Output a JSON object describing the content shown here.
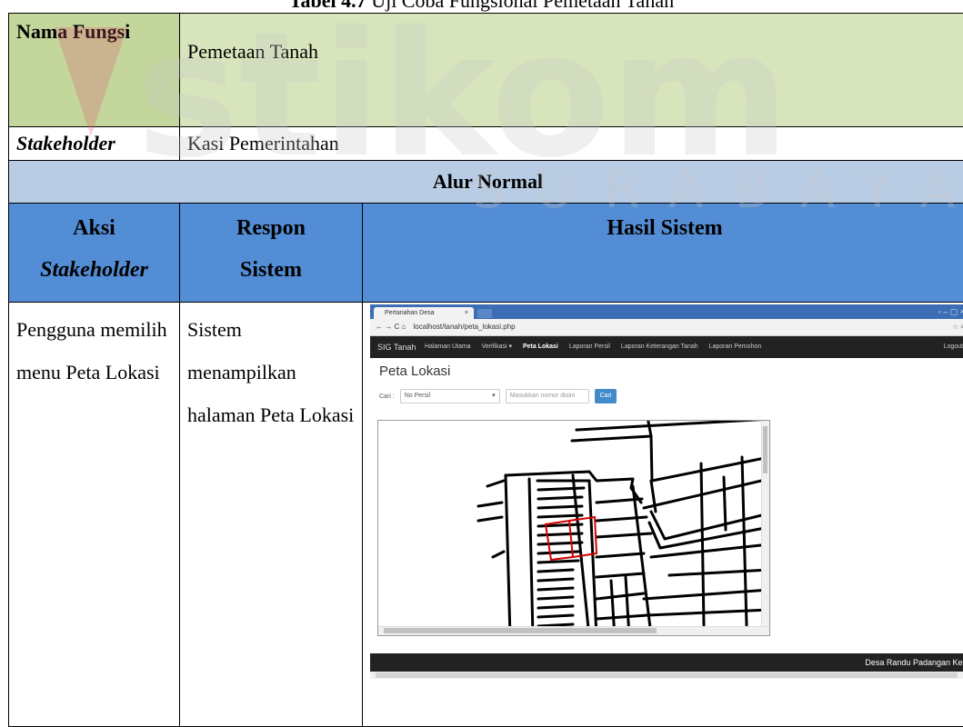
{
  "caption": {
    "label": "Tabel 4.7",
    "rest": "Uji Coba Fungsional Pemetaan Tanah"
  },
  "watermark": {
    "main": "stikom",
    "sub": "SURABAYA",
    "color": "#e8a0a8"
  },
  "table": {
    "nama_fungsi_label": "Nama Fungsi",
    "nama_fungsi_value": "Pemetaan Tanah",
    "stakeholder_label": "Stakeholder",
    "stakeholder_value": "Kasi Pemerintahan",
    "alur_normal": "Alur Normal",
    "col_aksi": "Aksi",
    "col_aksi_sub": "Stakeholder",
    "col_respon": "Respon",
    "col_respon_sub": "Sistem",
    "col_hasil": "Hasil Sistem",
    "aksi_text": "Pengguna memilih menu Peta Lokasi",
    "respon_text": "Sistem menampilkan halaman Peta Lokasi"
  },
  "screenshot": {
    "tab_title": "Pertanahan Desa",
    "url": "localhost/tanah/peta_lokasi.php",
    "brand": "SIG Tanah",
    "nav_items": [
      "Halaman Utama",
      "Verifikasi ▾",
      "Peta Lokasi",
      "Laporan Persil",
      "Laporan Keterangan Tanah",
      "Laporan Pemohon"
    ],
    "logout": "Logout",
    "page_title": "Peta Lokasi",
    "search_label": "Cari :",
    "search_select": "No Persil",
    "search_placeholder": "Masukkan nomor disini",
    "search_button": "Cari",
    "footer_text": "Desa Randu Padangan Kec"
  }
}
